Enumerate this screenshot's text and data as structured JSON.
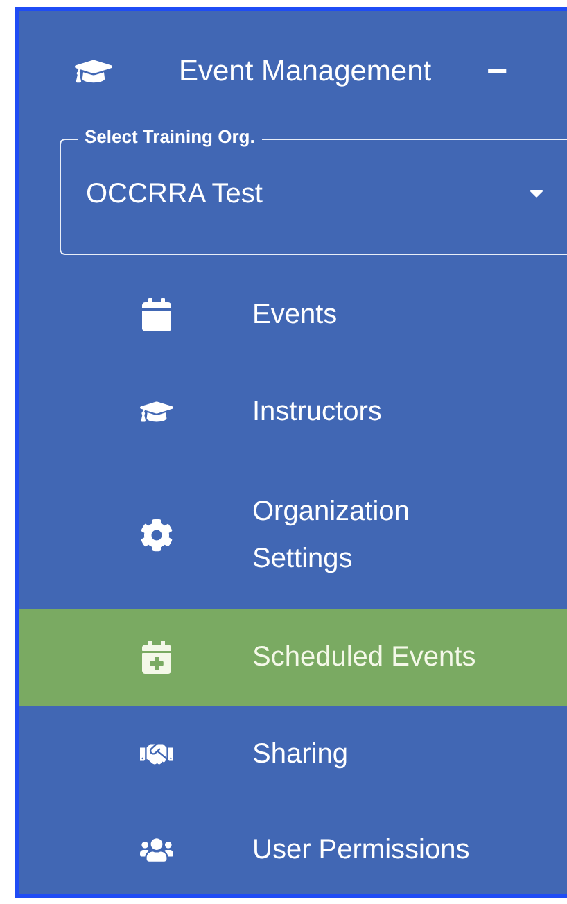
{
  "header": {
    "title": "Event Management",
    "toggle": "−"
  },
  "org_select": {
    "label": "Select Training Org.",
    "value": "OCCRRA Test"
  },
  "items": [
    {
      "label": "Events",
      "selected": false
    },
    {
      "label": "Instructors",
      "selected": false
    },
    {
      "label": "Organization Settings",
      "selected": false
    },
    {
      "label": "Scheduled Events",
      "selected": true
    },
    {
      "label": "Sharing",
      "selected": false
    },
    {
      "label": "User Permissions",
      "selected": false
    }
  ]
}
